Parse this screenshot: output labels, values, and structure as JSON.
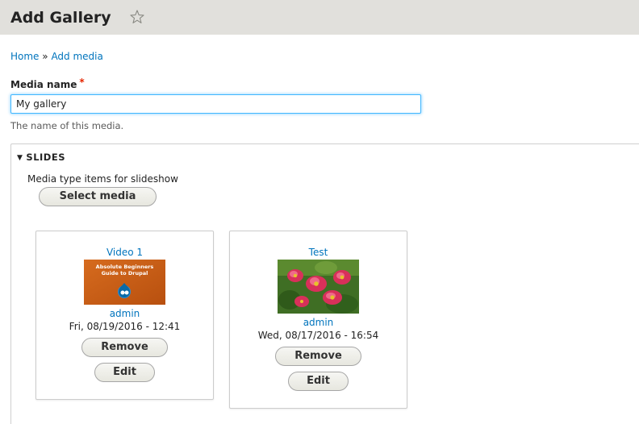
{
  "header": {
    "title": "Add Gallery",
    "star_icon": "star-outline-icon"
  },
  "breadcrumb": {
    "items": [
      "Home",
      "Add media"
    ],
    "separator": "»"
  },
  "form": {
    "media_name_label": "Media name",
    "required_marker": "*",
    "media_name_value": "My gallery",
    "media_name_description": "The name of this media."
  },
  "slides": {
    "summary": "SLIDES",
    "description": "Media type items for slideshow",
    "select_media_label": "Select media",
    "items": [
      {
        "title": "Video 1",
        "thumbnail_text_1": "Absolute Beginners",
        "thumbnail_text_2": "Guide to Drupal",
        "author": "admin",
        "date": "Fri, 08/19/2016 - 12:41",
        "remove_label": "Remove",
        "edit_label": "Edit"
      },
      {
        "title": "Test",
        "author": "admin",
        "date": "Wed, 08/17/2016 - 16:54",
        "remove_label": "Remove",
        "edit_label": "Edit"
      }
    ]
  },
  "colors": {
    "header_bg": "#e1e0dc",
    "link": "#0074bd",
    "required": "#e62600",
    "input_focus": "#40b6ff"
  }
}
